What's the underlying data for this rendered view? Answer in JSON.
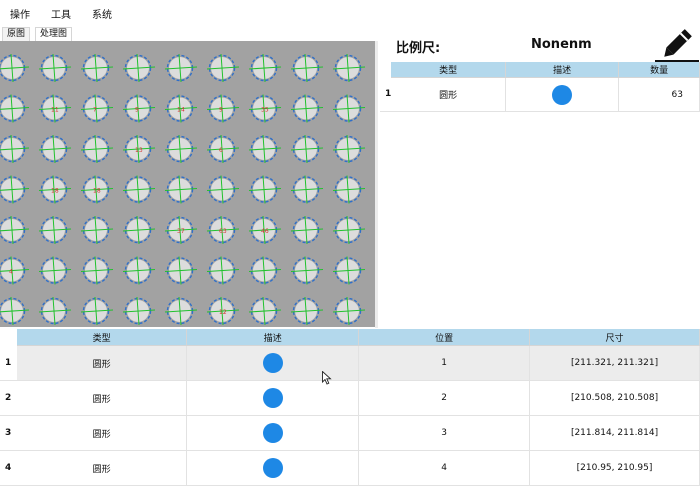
{
  "menu": {
    "items": [
      "操作",
      "工具",
      "系统"
    ]
  },
  "tabs": [
    {
      "label": "原图",
      "active": false
    },
    {
      "label": "处理图",
      "active": true
    }
  ],
  "scale": {
    "label": "比例尺:",
    "value": "Nonenm"
  },
  "icons": {
    "edit": "pencil-icon",
    "cursor": "mouse-cursor-icon"
  },
  "colors": {
    "header": "#b3d8ec",
    "shape_dot": "#1e88e5",
    "selected_row": "#ececec"
  },
  "image_overlay_labels": [
    [
      "",
      "",
      "",
      "",
      "",
      "",
      "",
      "",
      ""
    ],
    [
      "",
      "11",
      "7",
      "9",
      "14",
      "9",
      "35",
      "",
      ""
    ],
    [
      "",
      "",
      "",
      "13",
      "",
      "6",
      "",
      "",
      ""
    ],
    [
      "",
      "18",
      "18",
      "",
      "",
      "",
      "",
      "",
      ""
    ],
    [
      "",
      "",
      "",
      "",
      "37",
      "63",
      "46",
      "",
      ""
    ],
    [
      "4",
      "",
      "",
      "",
      "",
      "",
      "",
      "",
      ""
    ],
    [
      "",
      "",
      "",
      "",
      "",
      "12",
      "",
      "",
      ""
    ]
  ],
  "summary_table": {
    "columns": [
      "类型",
      "描述",
      "数量"
    ],
    "rows": [
      {
        "index": "1",
        "type": "圆形",
        "count": "63"
      }
    ]
  },
  "detail_table": {
    "columns": [
      "类型",
      "描述",
      "位置",
      "尺寸"
    ],
    "rows": [
      {
        "index": "1",
        "type": "圆形",
        "position": "1",
        "size": "[211.321, 211.321]",
        "selected": true
      },
      {
        "index": "2",
        "type": "圆形",
        "position": "2",
        "size": "[210.508, 210.508]",
        "selected": false
      },
      {
        "index": "3",
        "type": "圆形",
        "position": "3",
        "size": "[211.814, 211.814]",
        "selected": false
      },
      {
        "index": "4",
        "type": "圆形",
        "position": "4",
        "size": "[210.95, 210.95]",
        "selected": false
      }
    ]
  }
}
